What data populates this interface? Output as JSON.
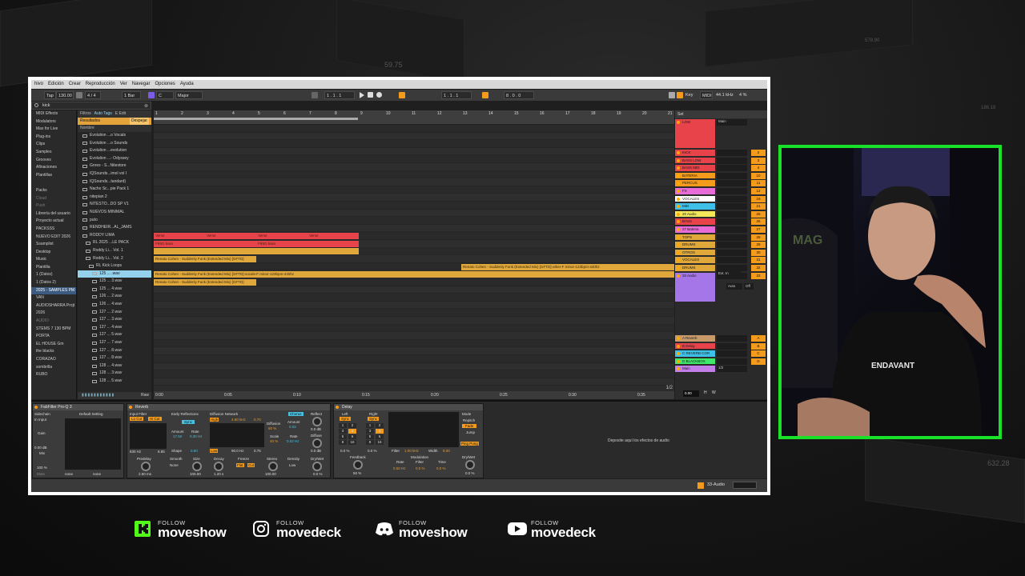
{
  "background": {
    "corner_numbers": [
      "59.75",
      "578.90",
      "186.18",
      "632.28"
    ]
  },
  "menu": [
    "hivo",
    "Edición",
    "Crear",
    "Reproducción",
    "Ver",
    "Navegar",
    "Opciones",
    "Ayuda"
  ],
  "transport": {
    "tap": "Tap",
    "tempo": "130.00",
    "signature": "4 / 4",
    "quantize": "1 Bar",
    "key_root": "C",
    "key_scale": "Major",
    "position": "1 . 1 . 1",
    "loop_start": "1 . 1 . 1",
    "loop_length": "8 . 0 . 0",
    "key_label": "Key",
    "midi": "MIDI",
    "sample_rate": "44.1 kHz",
    "cpu": "4 %"
  },
  "browser": {
    "search": "kick",
    "places": [
      {
        "label": "MIDI Effects",
        "dim": false
      },
      {
        "label": "Modulators",
        "dim": false
      },
      {
        "label": "Max for Live",
        "dim": false
      },
      {
        "label": "Plug-ins",
        "dim": false
      },
      {
        "label": "Clips",
        "dim": false
      },
      {
        "label": "Samples",
        "dim": false
      },
      {
        "label": "Grooves",
        "dim": false
      },
      {
        "label": "Afinaciones",
        "dim": false
      },
      {
        "label": "Plantillas",
        "dim": false
      },
      {
        "label": "",
        "dim": true
      },
      {
        "label": "Packs",
        "dim": false
      },
      {
        "label": "Cloud",
        "dim": true
      },
      {
        "label": "Push",
        "dim": true
      },
      {
        "label": "Librería del usuario",
        "dim": false
      },
      {
        "label": "Proyecto actual",
        "dim": false
      },
      {
        "label": "PACKSSS",
        "dim": false
      },
      {
        "label": "NUEVO EDIT 2026",
        "dim": false
      },
      {
        "label": "Ssamplist",
        "dim": false
      },
      {
        "label": "Desktop",
        "dim": false
      },
      {
        "label": "Music",
        "dim": false
      },
      {
        "label": "Plantilla",
        "dim": false
      },
      {
        "label": "1 (Datos)",
        "dim": false
      },
      {
        "label": "1 (Datos 2)",
        "dim": false
      },
      {
        "label": "2025 - SAMPLES PM",
        "dim": false
      },
      {
        "label": "VAN",
        "dim": false
      },
      {
        "label": "AUDIOSHARRA Projt",
        "dim": false
      },
      {
        "label": "2026",
        "dim": false
      },
      {
        "label": "AUDIO",
        "dim": true
      },
      {
        "label": "STEMS 7 130 BPM",
        "dim": false
      },
      {
        "label": "PORTA",
        "dim": false
      },
      {
        "label": "EL HOUSE Gm",
        "dim": false
      },
      {
        "label": "the blacks",
        "dim": false
      },
      {
        "label": "CORAZAO",
        "dim": false
      },
      {
        "label": "sombrilla",
        "dim": false
      },
      {
        "label": "RUBO",
        "dim": false
      }
    ],
    "tabs": {
      "filters": "Filtros",
      "autotags": "Auto Tags",
      "edit": "E Edit"
    },
    "results_label": "Resultados",
    "clear_label": "Despejar",
    "column_name": "Nombre",
    "items": [
      {
        "label": "Evolution ...o Vocals",
        "indent": 1,
        "selected": false
      },
      {
        "label": "Evolution ...o Sounds",
        "indent": 1,
        "selected": false
      },
      {
        "label": "Evolution ...evolution",
        "indent": 1,
        "selected": false
      },
      {
        "label": "Evolution ...- Odyssey",
        "indent": 1,
        "selected": false
      },
      {
        "label": "Gnres - S...Nitestore",
        "indent": 1,
        "selected": false
      },
      {
        "label": "IQSounds...imol vol I",
        "indent": 1,
        "selected": false
      },
      {
        "label": "IQSounds...tandard)",
        "indent": 1,
        "selected": false
      },
      {
        "label": "Nacho Sc...pie Pack 1",
        "indent": 1,
        "selected": false
      },
      {
        "label": "nitepian 2",
        "indent": 1,
        "selected": false
      },
      {
        "label": "NITESTO...DO SP V1",
        "indent": 1,
        "selected": false
      },
      {
        "label": "NUEVOS MINIMAL",
        "indent": 1,
        "selected": false
      },
      {
        "label": "puto",
        "indent": 1,
        "selected": false
      },
      {
        "label": "RENDHEIR...AL_JAMS",
        "indent": 1,
        "selected": false
      },
      {
        "label": "RODDY LIMA",
        "indent": 1,
        "selected": false
      },
      {
        "label": "RL 2025 ...LE PACK",
        "indent": 2,
        "selected": false
      },
      {
        "label": "Roddy Li... Vol. 1",
        "indent": 2,
        "selected": false
      },
      {
        "label": "Roddy Li... Vol. 2",
        "indent": 2,
        "selected": false
      },
      {
        "label": "RL Kick Loops",
        "indent": 3,
        "selected": false
      },
      {
        "label": "125 ... .wav",
        "indent": 4,
        "selected": true
      },
      {
        "label": "125 ... 3.wav",
        "indent": 4,
        "selected": false
      },
      {
        "label": "125 ... 4.wav",
        "indent": 4,
        "selected": false
      },
      {
        "label": "126 ... 2.wav",
        "indent": 4,
        "selected": false
      },
      {
        "label": "126 ... 4.wav",
        "indent": 4,
        "selected": false
      },
      {
        "label": "127 ... 2.wav",
        "indent": 4,
        "selected": false
      },
      {
        "label": "127 ... 3.wav",
        "indent": 4,
        "selected": false
      },
      {
        "label": "127 ... 4.wav",
        "indent": 4,
        "selected": false
      },
      {
        "label": "127 ... 5.wav",
        "indent": 4,
        "selected": false
      },
      {
        "label": "127 ... 7.wav",
        "indent": 4,
        "selected": false
      },
      {
        "label": "127 ... 8.wav",
        "indent": 4,
        "selected": false
      },
      {
        "label": "127 ... 8.wav",
        "indent": 4,
        "selected": false
      },
      {
        "label": "128 ... 4.wav",
        "indent": 4,
        "selected": false
      },
      {
        "label": "128 ... 3.wav",
        "indent": 4,
        "selected": false
      },
      {
        "label": "128 ... 5.wav",
        "indent": 4,
        "selected": false
      }
    ],
    "raw": "Raw"
  },
  "arrangement": {
    "ruler": [
      "1",
      "2",
      "3",
      "4",
      "5",
      "6",
      "7",
      "8",
      "9",
      "10",
      "11",
      "12",
      "13",
      "14",
      "15",
      "16",
      "17",
      "18",
      "19",
      "20",
      "21"
    ],
    "clips": [
      {
        "text": "Verse",
        "lane": 14,
        "start": 0,
        "end": 8,
        "color": "#e8424a"
      },
      {
        "text": "Verse",
        "lane": 14,
        "start": 2,
        "end": 3,
        "color": "#e8424a"
      },
      {
        "text": "Verse",
        "lane": 14,
        "start": 4,
        "end": 5,
        "color": "#e8424a"
      },
      {
        "text": "Verse",
        "lane": 14,
        "start": 6,
        "end": 7,
        "color": "#e8424a"
      },
      {
        "text": "F9SD bass",
        "lane": 15,
        "start": 0,
        "end": 8,
        "color": "#e8424a"
      },
      {
        "text": "F9SD bass",
        "lane": 15,
        "start": 4,
        "end": 5,
        "color": "#e8424a"
      },
      {
        "text": "",
        "lane": 16,
        "start": 0,
        "end": 8,
        "color": "#e0a73a"
      },
      {
        "text": "Renato Cohen - Suddenly Funk (Extended Mix) [GFTD]",
        "lane": 17,
        "start": 0,
        "end": 4,
        "color": "#e0a73a"
      },
      {
        "text": "Renato Cohen - Suddenly Funk (Extended Mix) [GFTD]-other-F minor-123bpm-440hz",
        "lane": 18,
        "start": 12,
        "end": 20.5,
        "color": "#e0a73a"
      },
      {
        "text": "Renato Cohen - Suddenly Funk (Extended Mix) [GFTD]-vocals-F minor-123bpm-440hz",
        "lane": 19,
        "start": 0,
        "end": 20.5,
        "color": "#e0a73a"
      },
      {
        "text": "Renato Cohen - Suddenly Funk (Extended Mix) [GFTD]",
        "lane": 20,
        "start": 0,
        "end": 4,
        "color": "#e0a73a"
      }
    ],
    "timeline": [
      "0:00",
      "0:05",
      "0:10",
      "0:15",
      "0:20",
      "0:25",
      "0:30",
      "0:35"
    ],
    "page": "1/2"
  },
  "mixer": {
    "set_label": "Set",
    "main_route": "Main",
    "tracks": [
      {
        "name": "LOW",
        "color": "#e8424a",
        "num": "",
        "tall": true
      },
      {
        "name": "KICK",
        "color": "#e8424a",
        "num": "2"
      },
      {
        "name": "BASS LOW",
        "color": "#e8424a",
        "num": "3"
      },
      {
        "name": "BASS MID",
        "color": "#e8424a",
        "num": "4"
      },
      {
        "name": "BATERIA",
        "color": "#f59b1b",
        "num": "10"
      },
      {
        "name": "PERCUS",
        "color": "#f59b1b",
        "num": "11"
      },
      {
        "name": "FX",
        "color": "#e86cd8",
        "num": "12"
      },
      {
        "name": "VOCALES",
        "color": "#ffffff",
        "num": "19"
      },
      {
        "name": "MID",
        "color": "#3ec0e8",
        "num": "21"
      },
      {
        "name": "20 Audio",
        "color": "#f2e85a",
        "num": "25"
      },
      {
        "name": "BASS",
        "color": "#e8424a",
        "num": "26"
      },
      {
        "name": "27 Bateria",
        "color": "#e86cd8",
        "num": "27"
      },
      {
        "name": "TOPS",
        "color": "#e0a73a",
        "num": "28"
      },
      {
        "name": "DRUMS",
        "color": "#e0a73a",
        "num": "29"
      },
      {
        "name": "OTROS",
        "color": "#e0a73a",
        "num": "30"
      },
      {
        "name": "VOCALES",
        "color": "#e0a73a",
        "num": "31"
      },
      {
        "name": "DRUMS",
        "color": "#e0a73a",
        "num": "32"
      },
      {
        "name": "33 Audio",
        "color": "#a576e8",
        "num": "33",
        "tall": true
      },
      {
        "name": "A Reverb",
        "color": "#c89a6a",
        "num": "A"
      },
      {
        "name": "B Delay",
        "color": "#e8424a",
        "num": "B"
      },
      {
        "name": "C REVERB COR",
        "color": "#3ec0e8",
        "num": "C"
      },
      {
        "name": "D BLACKBOX",
        "color": "#3ee86a",
        "num": "D"
      },
      {
        "name": "Main",
        "color": "#c27de8",
        "num": "",
        "route": "1/2"
      }
    ],
    "ext_in": "Ext. In",
    "auto": "Auto",
    "off": "Off",
    "master_vol": "0.00",
    "h_label": "H",
    "w_label": "W"
  },
  "devices": {
    "fabfilter": {
      "title": "FabFilter Pro-Q 3",
      "preset": "Default Setting",
      "sidechain": "Sidechain",
      "input": "In Input",
      "gain_label": "Gain",
      "gain": "0.00 dB",
      "mix_label": "Mix",
      "mix": "100 %",
      "mute": "Mute",
      "none1": "none",
      "none2": "none"
    },
    "reverb": {
      "title": "Reverb",
      "input_filter": "Input Filter",
      "lo_cut": "Lo Cut",
      "hi_cut": "Hi Cut",
      "freq_lo": "830 Hz",
      "freq_hi": "6.85",
      "early": "Early Reflections",
      "sync": "Sync",
      "amount_label": "Amount",
      "amount": "17.50",
      "rate_label": "Rate",
      "rate": "0.30 Hz",
      "shape_label": "Shape",
      "shape": "0.60",
      "diffusion": "Diffusion Network",
      "chorus": "Chorus",
      "high": "High",
      "hi_freq": "4.60 kHz",
      "hi_val": "0.70",
      "low": "Low",
      "low_freq": "90.0 Hz",
      "low_val": "0.75",
      "diffusion_label": "Diffusion",
      "diffusion_val": "60 %",
      "scale_label": "Scale",
      "scale_val": "40 %",
      "chorus_amount_label": "Amount",
      "chorus_amount": "0.02",
      "chorus_rate_label": "Rate",
      "chorus_rate": "0.02 Hz",
      "reflect_label": "Reflect",
      "reflect": "0.0 dB",
      "diffuse_label": "Diffuse",
      "diffuse": "0.0 dB",
      "predelay_label": "Predelay",
      "predelay": "2.50 ms",
      "smooth_label": "Smooth",
      "smooth": "None",
      "size_label": "Size",
      "size": "100.00",
      "decay_label": "Decay",
      "decay": "1.20 s",
      "freeze_label": "Freeze",
      "flat": "Flat",
      "cut": "Cut",
      "stereo_label": "Stereo",
      "stereo": "100.00",
      "density_label": "Density",
      "density": "Low",
      "drywet_label": "Dry/Wet",
      "drywet": "0.0 %"
    },
    "delay": {
      "title": "Delay",
      "left": "Left",
      "right": "Right",
      "sync_l": "Sync",
      "sync_r": "Sync",
      "grid_l": [
        "1",
        "2",
        "3",
        "4",
        "5",
        "6",
        "8",
        "16"
      ],
      "grid_r": [
        "1",
        "2",
        "3",
        "4",
        "5",
        "6",
        "8",
        "16"
      ],
      "pct_l": "0.0 %",
      "pct_r": "0.0 %",
      "feedback_label": "Feedback",
      "feedback": "50 %",
      "filter_label": "Filter",
      "filter_freq": "1.00 kHz",
      "width_label": "Width",
      "width": "8.00",
      "modulation": "Modulation",
      "rate_label": "Rate",
      "rate": "0.50 Hz",
      "mfilter_label": "Filter",
      "mfilter": "0.0 %",
      "time_label": "Time",
      "time": "0.0 %",
      "mode_label": "Mode",
      "repitch": "Repitch",
      "fade": "Fade",
      "jump": "Jump",
      "pingpong": "Ping Pong",
      "drywet_label": "Dry/Wet",
      "drywet": "0.0 %"
    },
    "drop_hint": "Deposite aquí los efectos de audio"
  },
  "status": {
    "track": "33-Audio"
  },
  "socials": [
    {
      "icon": "kick-icon",
      "follow": "FOLLOW",
      "handle": "moveshow",
      "color": "#53fc18"
    },
    {
      "icon": "instagram-icon",
      "follow": "FOLLOW",
      "handle": "movedeck",
      "color": "#ffffff"
    },
    {
      "icon": "discord-icon",
      "follow": "FOLLOW",
      "handle": "moveshow",
      "color": "#ffffff"
    },
    {
      "icon": "youtube-icon",
      "follow": "FOLLOW",
      "handle": "movedeck",
      "color": "#ffffff"
    }
  ],
  "webcam": {
    "shirt_text": "ENDAVANT",
    "poster_text": "MAG"
  }
}
